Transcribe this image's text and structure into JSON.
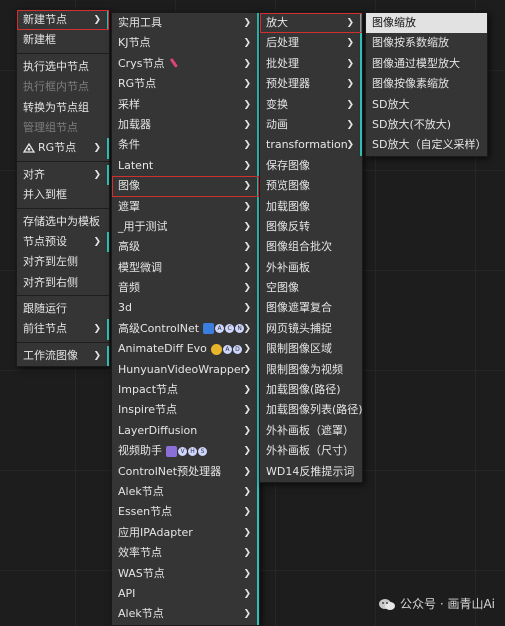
{
  "menu1": {
    "items": [
      {
        "label": "新建节点",
        "submenu": true,
        "state": "active"
      },
      {
        "label": "新建框"
      },
      {
        "sep": true
      },
      {
        "label": "执行选中节点"
      },
      {
        "label": "执行框内节点",
        "disabled": true
      },
      {
        "label": "转换为节点组"
      },
      {
        "label": "管理组节点",
        "disabled": true
      },
      {
        "label": "RG节点",
        "submenu": true,
        "icon": "rg-logo-icon"
      },
      {
        "sep": true
      },
      {
        "label": "对齐",
        "submenu": true
      },
      {
        "label": "并入到框"
      },
      {
        "sep": true
      },
      {
        "label": "存储选中为模板"
      },
      {
        "label": "节点预设",
        "submenu": true
      },
      {
        "label": "对齐到左侧"
      },
      {
        "label": "对齐到右侧"
      },
      {
        "sep": true
      },
      {
        "label": "跟随运行"
      },
      {
        "label": "前往节点",
        "submenu": true
      },
      {
        "sep": true
      },
      {
        "label": "工作流图像",
        "submenu": true
      }
    ]
  },
  "menu2": {
    "items": [
      {
        "label": "实用工具",
        "submenu": true
      },
      {
        "label": "KJ节点",
        "submenu": true
      },
      {
        "label": "Crys节点",
        "submenu": true,
        "icon": "test-tube-icon"
      },
      {
        "label": "RG节点",
        "submenu": true
      },
      {
        "label": "采样",
        "submenu": true
      },
      {
        "label": "加载器",
        "submenu": true
      },
      {
        "label": "条件",
        "submenu": true
      },
      {
        "label": "Latent",
        "submenu": true
      },
      {
        "label": "图像",
        "submenu": true,
        "state": "active"
      },
      {
        "label": "遮罩",
        "submenu": true
      },
      {
        "label": "_用于测试",
        "submenu": true
      },
      {
        "label": "高级",
        "submenu": true
      },
      {
        "label": "模型微调",
        "submenu": true
      },
      {
        "label": "音频",
        "submenu": true
      },
      {
        "label": "3d",
        "submenu": true
      },
      {
        "label": "高级ControlNet",
        "submenu": true,
        "icon": "controlnet-badge-icon",
        "glyphs": [
          "A",
          "C",
          "N"
        ]
      },
      {
        "label": "AnimateDiff Evo",
        "submenu": true,
        "icon": "animatediff-badge-icon",
        "glyphs": [
          "A",
          "D"
        ]
      },
      {
        "label": "HunyuanVideoWrapper",
        "submenu": true
      },
      {
        "label": "Impact节点",
        "submenu": true
      },
      {
        "label": "Inspire节点",
        "submenu": true
      },
      {
        "label": "LayerDiffusion",
        "submenu": true
      },
      {
        "label": "视频助手",
        "submenu": true,
        "icon": "video-helper-icon",
        "glyphs": [
          "V",
          "H",
          "S"
        ]
      },
      {
        "label": "ControlNet预处理器",
        "submenu": true
      },
      {
        "label": "Alek节点",
        "submenu": true
      },
      {
        "label": "Essen节点",
        "submenu": true
      },
      {
        "label": "应用IPAdapter",
        "submenu": true
      },
      {
        "label": "效率节点",
        "submenu": true
      },
      {
        "label": "WAS节点",
        "submenu": true
      },
      {
        "label": "API",
        "submenu": true
      },
      {
        "label": "Alek节点",
        "submenu": true
      }
    ]
  },
  "menu3": {
    "items": [
      {
        "label": "放大",
        "submenu": true,
        "state": "active"
      },
      {
        "label": "后处理",
        "submenu": true
      },
      {
        "label": "批处理",
        "submenu": true
      },
      {
        "label": "预处理器",
        "submenu": true
      },
      {
        "label": "变换",
        "submenu": true
      },
      {
        "label": "动画",
        "submenu": true
      },
      {
        "label": "transformation",
        "submenu": true
      },
      {
        "label": "保存图像"
      },
      {
        "label": "预览图像"
      },
      {
        "label": "加载图像"
      },
      {
        "label": "图像反转"
      },
      {
        "label": "图像组合批次"
      },
      {
        "label": "外补画板"
      },
      {
        "label": "空图像"
      },
      {
        "label": "图像遮罩复合"
      },
      {
        "label": "网页镜头捕捉"
      },
      {
        "label": "限制图像区域"
      },
      {
        "label": "限制图像为视频"
      },
      {
        "label": "加载图像(路径)"
      },
      {
        "label": "加载图像列表(路径)"
      },
      {
        "label": "外补画板（遮罩）"
      },
      {
        "label": "外补画板（尺寸）"
      },
      {
        "label": "WD14反推提示词"
      }
    ]
  },
  "menu4": {
    "items": [
      {
        "label": "图像缩放",
        "state": "highlighted"
      },
      {
        "label": "图像按系数缩放"
      },
      {
        "label": "图像通过模型放大"
      },
      {
        "label": "图像按像素缩放"
      },
      {
        "label": "SD放大"
      },
      {
        "label": "SD放大(不放大)"
      },
      {
        "label": "SD放大（自定义采样）"
      }
    ]
  },
  "watermark": {
    "text": "公众号 · 画青山Ai",
    "icon": "wechat-icon"
  },
  "colors": {
    "submenu_accent": "#2ec0b8",
    "active_border": "#d03030",
    "highlight_bg": "#e2e2e2"
  }
}
